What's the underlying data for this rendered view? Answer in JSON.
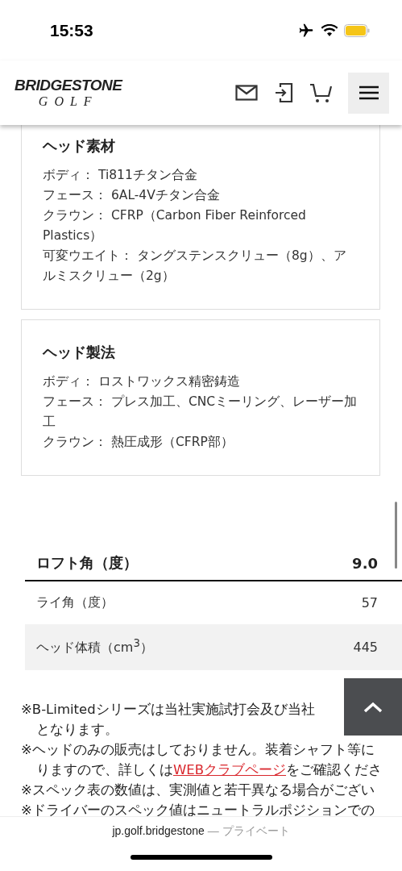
{
  "status_bar": {
    "time": "15:53"
  },
  "header": {
    "logo_brand": "BRIDGESTONE",
    "logo_sub": "GOLF"
  },
  "sections": [
    {
      "title": "ヘッド素材",
      "lines": [
        "ボディ： Ti811チタン合金",
        "フェース： 6AL-4Vチタン合金",
        "クラウン： CFRP（Carbon Fiber Reinforced Plastics）",
        "可変ウエイト： タングステンスクリュー（8g）、アルミスクリュー（2g）"
      ]
    },
    {
      "title": "ヘッド製法",
      "lines": [
        "ボディ： ロストワックス精密鋳造",
        "フェース： プレス加工、CNCミーリング、レーザー加工",
        "クラウン： 熱圧成形（CFRP部）"
      ]
    }
  ],
  "spec_table": {
    "rows": [
      {
        "kind": "header",
        "label": "ロフト角（度）",
        "value": "9.0",
        "shaded": false
      },
      {
        "kind": "row",
        "label": "ライ角（度）",
        "value": "57",
        "shaded": false
      },
      {
        "kind": "row",
        "label": "ヘッド体積（cm$^{3}$）",
        "value": "445",
        "shaded": true
      }
    ]
  },
  "notes": [
    {
      "lines": [
        {
          "text": "※B-Limitedシリーズは当社実施試打会及び当社"
        },
        {
          "text": "となります。"
        }
      ]
    },
    {
      "lines": [
        {
          "text": "※ヘッドのみの販売はしておりません。装着シャフト等に"
        },
        {
          "text": "りますので、詳しくは",
          "link": "WEBクラブページ",
          "after": "をご確認くださ"
        }
      ]
    },
    {
      "lines": [
        {
          "text": "※スペック表の数値は、実測値と若干異なる場合がござい"
        }
      ]
    },
    {
      "lines": [
        {
          "text": "※ドライバーのスペック値はニュートラルポジションでの"
        }
      ]
    }
  ],
  "url_bar": {
    "domain": "jp.golf.bridgestone",
    "suffix": "— プライベート"
  }
}
